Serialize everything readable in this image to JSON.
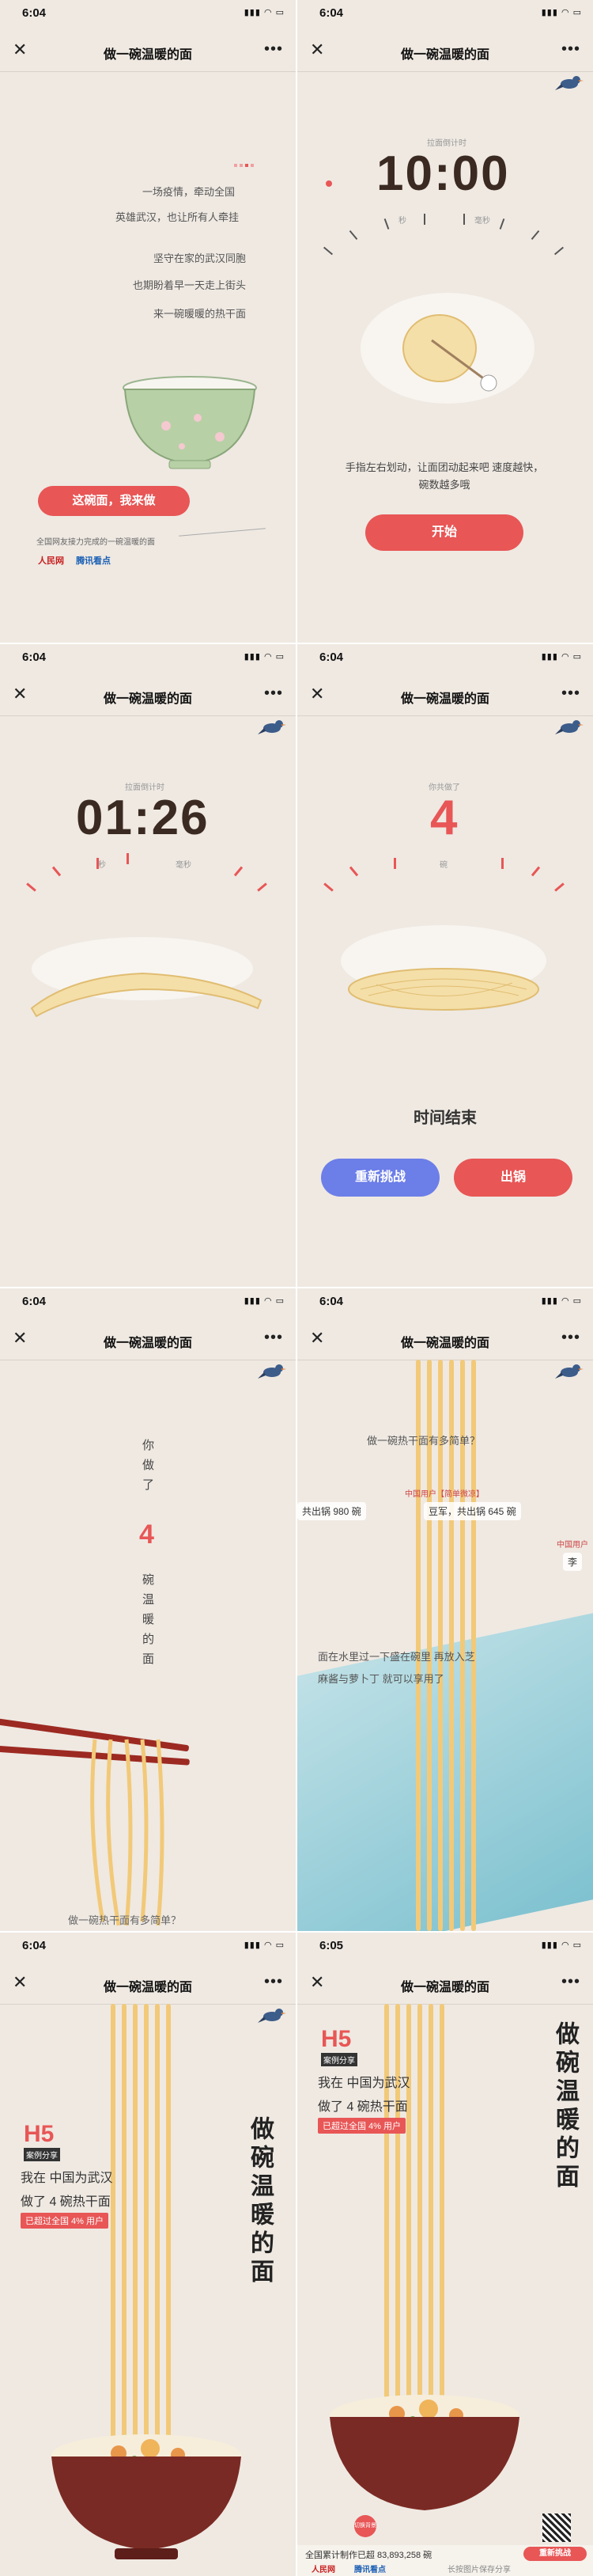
{
  "app": {
    "time": "6:04",
    "time_last": "6:05",
    "title": "做一碗温暖的面",
    "close_glyph": "✕",
    "more_glyph": "•••"
  },
  "screen1": {
    "lines": [
      "一场疫情，牵动全国",
      "英雄武汉，也让所有人牵挂",
      "坚守在家的武汉同胞",
      "也期盼着早一天走上街头",
      "来一碗暖暖的热干面"
    ],
    "cta": "这碗面，我来做",
    "caption": "全国网友接力完成的一碗温暖的面",
    "logo1": "人民网",
    "logo2": "腾讯看点"
  },
  "screen2": {
    "timer_label": "拉面倒计时",
    "timer": "10:00",
    "unit1": "秒",
    "unit2": "毫秒",
    "instructions": "手指左右划动，让面团动起来吧 速度越快，碗数越多哦",
    "start": "开始"
  },
  "screen3": {
    "timer_label": "拉面倒计时",
    "timer": "01:26",
    "unit1": "秒",
    "unit2": "毫秒"
  },
  "screen4": {
    "count_label": "你共做了",
    "count": "4",
    "count_unit": "碗",
    "over": "时间结束",
    "retry": "重新挑战",
    "serve": "出锅"
  },
  "screen5": {
    "v1": "你做了",
    "num": "4",
    "v2": "碗温暖的面",
    "bottom": "做一碗热干面有多简单？"
  },
  "screen6": {
    "question": "做一碗热干面有多简单？",
    "tag_user": "中国用户【简单微凉】",
    "tag1": "共出锅 980 碗",
    "tag2": "豆军，共出锅 645 碗",
    "tag3": "中国用户",
    "tag4": "李",
    "recipe": "面在水里过一下盛在碗里 再放入芝麻酱与萝卜丁 就可以享用了"
  },
  "screen7": {
    "h5": "H5",
    "h5_sub": "案例分享",
    "line1": "我在  中国为武汉",
    "line2": "做了 4 碗热干面",
    "badge": "已超过全国 4% 用户",
    "title_vert": "做碗温暖的面"
  },
  "screen8": {
    "h5": "H5",
    "h5_sub": "案例分享",
    "line1": "我在  中国为武汉",
    "line2": "做了 4 碗热干面",
    "badge": "已超过全国 4% 用户",
    "title_vert": "做碗温暖的面",
    "switch_bg": "切换背景",
    "total": "全国累计制作已超 83,893,258 碗",
    "regen": "重新挑战",
    "save_hint": "长按图片保存分享",
    "logo1": "人民网",
    "logo2": "腾讯看点"
  },
  "colors": {
    "bg": "#efe9e2",
    "red": "#e85656",
    "blue": "#6c7ee8",
    "noodle": "#f2c978",
    "bowl": "#7a2a24"
  }
}
